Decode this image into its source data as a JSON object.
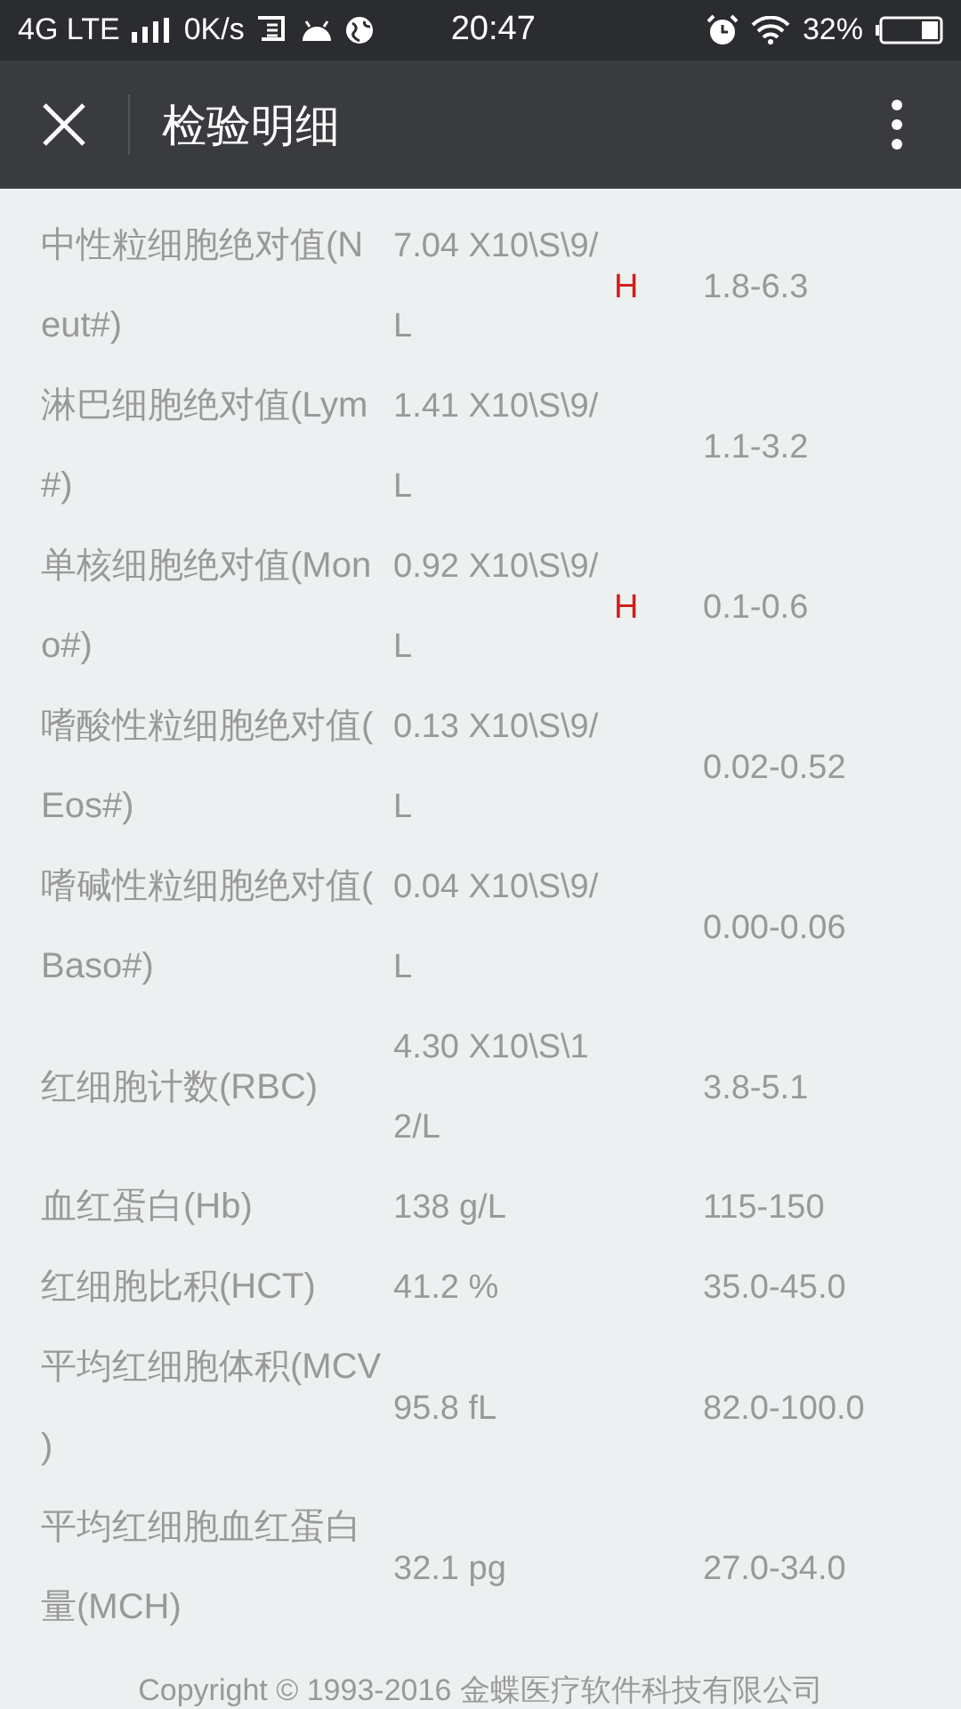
{
  "status_bar": {
    "network": "4G LTE",
    "speed": "0K/s",
    "time": "20:47",
    "battery": "32%"
  },
  "app_bar": {
    "title": "检验明细"
  },
  "results": [
    {
      "name": "中性粒细胞绝对值(N\neut#)",
      "value": "7.04 X10\\S\\9/\nL",
      "flag": "H",
      "range": "1.8-6.3"
    },
    {
      "name": "淋巴细胞绝对值(Lym\n#)",
      "value": "1.41 X10\\S\\9/\nL",
      "range": "1.1-3.2"
    },
    {
      "name": "单核细胞绝对值(Mon\no#)",
      "value": "0.92 X10\\S\\9/\nL",
      "flag": "H",
      "range": "0.1-0.6"
    },
    {
      "name": "嗜酸性粒细胞绝对值(\nEos#)",
      "value": "0.13 X10\\S\\9/\nL",
      "range": "0.02-0.52"
    },
    {
      "name": "嗜碱性粒细胞绝对值(\nBaso#)",
      "value": "0.04 X10\\S\\9/\nL",
      "range": "0.00-0.06"
    },
    {
      "name": "红细胞计数(RBC)",
      "value": "4.30 X10\\S\\1\n2/L",
      "range": "3.8-5.1"
    },
    {
      "name": "血红蛋白(Hb)",
      "value": "138 g/L",
      "range": "115-150"
    },
    {
      "name": "红细胞比积(HCT)",
      "value": "41.2 %",
      "range": "35.0-45.0"
    },
    {
      "name": "平均红细胞体积(MCV\n)",
      "value": "95.8 fL",
      "range": "82.0-100.0"
    },
    {
      "name": "平均红细胞血红蛋白量(MCH)",
      "value": "32.1 pg",
      "range": "27.0-34.0"
    }
  ],
  "footer": "Copyright © 1993-2016 金蝶医疗软件科技有限公司"
}
